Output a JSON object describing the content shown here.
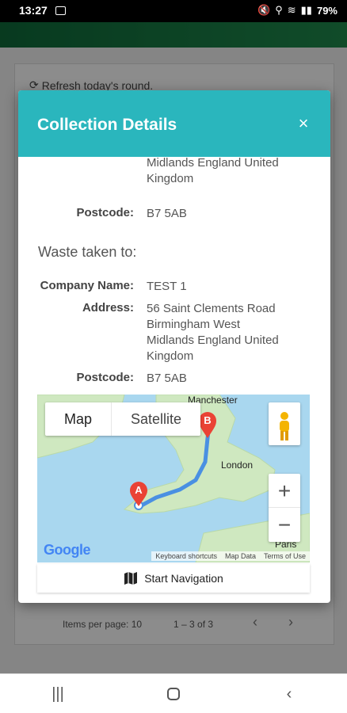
{
  "statusbar": {
    "time": "13:27",
    "battery": "79%"
  },
  "background": {
    "refresh_label": "Refresh today's round.",
    "items_per_page": "Items per page: 10",
    "range": "1 – 3 of 3"
  },
  "dialog": {
    "title": "Collection Details",
    "close_icon": "×",
    "address_tail": [
      "Midlands England United",
      "Kingdom"
    ],
    "postcode_label": "Postcode:",
    "postcode_1": "B7 5AB",
    "waste_heading": "Waste taken to:",
    "company_label": "Company Name:",
    "company_value": "TEST 1",
    "address_label": "Address:",
    "address_lines": [
      "56 Saint Clements Road",
      "Birmingham West",
      "Midlands England United",
      "Kingdom"
    ],
    "postcode_2": "B7 5AB"
  },
  "map": {
    "map_label": "Map",
    "satellite_label": "Satellite",
    "zoom_in": "+",
    "zoom_out": "−",
    "google": "Google",
    "footer": [
      "Keyboard shortcuts",
      "Map Data",
      "Terms of Use"
    ],
    "cities": [
      "Manchester",
      "London",
      "Paris"
    ],
    "marker_a": "A",
    "marker_b": "B",
    "colors": {
      "water": "#a9d7ef",
      "land": "#cfe8c0",
      "route": "#4a90e2",
      "marker": "#ea4335"
    }
  },
  "navigation": {
    "start_label": "Start Navigation"
  }
}
